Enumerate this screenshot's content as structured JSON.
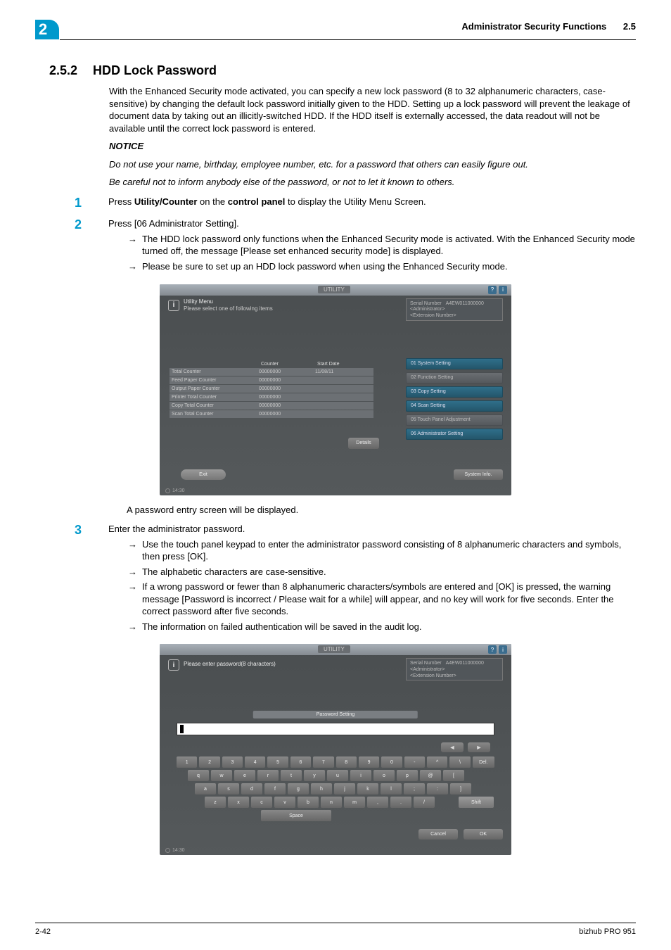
{
  "header": {
    "chapter_number": "2",
    "breadcrumb": "Administrator Security Functions",
    "section_ref": "2.5"
  },
  "section": {
    "number": "2.5.2",
    "title": "HDD Lock Password"
  },
  "intro": "With the Enhanced Security mode activated, you can specify a new lock password (8 to 32 alphanumeric characters, case-sensitive) by changing the default lock password initially given to the HDD. Setting up a lock password will prevent the leakage of document data by taking out an illicitly-switched HDD. If the HDD itself is externally accessed, the data readout will not be available until the correct lock password is entered.",
  "notice": {
    "label": "NOTICE",
    "line1": "Do not use your name, birthday, employee number, etc. for a password that others can easily figure out.",
    "line2": "Be careful not to inform anybody else of the password, or not to let it known to others."
  },
  "steps": {
    "s1": {
      "num": "1",
      "prefix": "Press ",
      "bold1": "Utility/Counter",
      "mid": " on the ",
      "bold2": "control panel",
      "suffix": " to display the Utility Menu Screen."
    },
    "s2": {
      "num": "2",
      "line": "Press [06 Administrator Setting].",
      "arrow1": "The HDD lock password only functions when the Enhanced Security mode is activated. With the Enhanced Security mode turned off, the message [Please set enhanced security mode] is displayed.",
      "arrow2": "Please be sure to set up an HDD lock password when using the Enhanced Security mode."
    },
    "after_ss1": "A password entry screen will be displayed.",
    "s3": {
      "num": "3",
      "line": "Enter the administrator password.",
      "arrow1": "Use the touch panel keypad to enter the administrator password consisting of 8 alphanumeric characters and symbols, then press [OK].",
      "arrow2": "The alphabetic characters are case-sensitive.",
      "arrow3": "If a wrong password or fewer than 8 alphanumeric characters/symbols are entered and [OK] is pressed, the warning message [Password is incorrect / Please wait for a while] will appear, and no key will work for five seconds. Enter the correct password after five seconds.",
      "arrow4": "The information on failed authentication will be saved in the audit log."
    }
  },
  "ss1": {
    "topbar": "UTILITY",
    "menu_title": "Utility Menu",
    "menu_sub": "Please select one of following items",
    "serial": {
      "label": "Serial Number",
      "value": "A4EW011000000",
      "admin": "<Administrator>",
      "ext": "<Extension Number>"
    },
    "counter_headers": {
      "c1": "",
      "c2": "Counter",
      "c3": "Start Date"
    },
    "counter_rows": [
      {
        "label": "Total Counter",
        "count": "00000000",
        "date": "11/08/11"
      },
      {
        "label": "Feed Paper Counter",
        "count": "00000000",
        "date": ""
      },
      {
        "label": "Output Paper Counter",
        "count": "00000000",
        "date": ""
      },
      {
        "label": "Printer Total Counter",
        "count": "00000000",
        "date": ""
      },
      {
        "label": "Copy Total Counter",
        "count": "00000000",
        "date": ""
      },
      {
        "label": "Scan Total Counter",
        "count": "00000000",
        "date": ""
      }
    ],
    "details": "Details",
    "menu_items": [
      "01 System Setting",
      "02 Function Setting",
      "03 Copy Setting",
      "04 Scan Setting",
      "05 Touch Panel Adjustment",
      "06 Administrator Setting"
    ],
    "exit": "Exit",
    "sysinfo": "System Info.",
    "clock": "14:30"
  },
  "ss2": {
    "topbar": "UTILITY",
    "menu_title": "Please enter password(8 characters)",
    "serial": {
      "label": "Serial Number",
      "value": "A4EW011000000",
      "admin": "<Administrator>",
      "ext": "<Extension Number>"
    },
    "pwd_heading": "Password Setting",
    "arrows": {
      "left": "◄",
      "right": "►"
    },
    "kbd_row1": [
      "1",
      "2",
      "3",
      "4",
      "5",
      "6",
      "7",
      "8",
      "9",
      "0",
      "-",
      "^",
      "\\"
    ],
    "kbd_del": "Del.",
    "kbd_row2": [
      "q",
      "w",
      "e",
      "r",
      "t",
      "y",
      "u",
      "i",
      "o",
      "p",
      "@",
      "["
    ],
    "kbd_row3": [
      "a",
      "s",
      "d",
      "f",
      "g",
      "h",
      "j",
      "k",
      "l",
      ";",
      ":",
      "]"
    ],
    "kbd_row4": [
      "z",
      "x",
      "c",
      "v",
      "b",
      "n",
      "m",
      ",",
      ".",
      "/"
    ],
    "kbd_shift": "Shift",
    "kbd_space": "Space",
    "cancel": "Cancel",
    "ok": "OK",
    "clock": "14:30"
  },
  "footer": {
    "left": "2-42",
    "right": "bizhub PRO 951"
  },
  "arrow_glyph": "→"
}
